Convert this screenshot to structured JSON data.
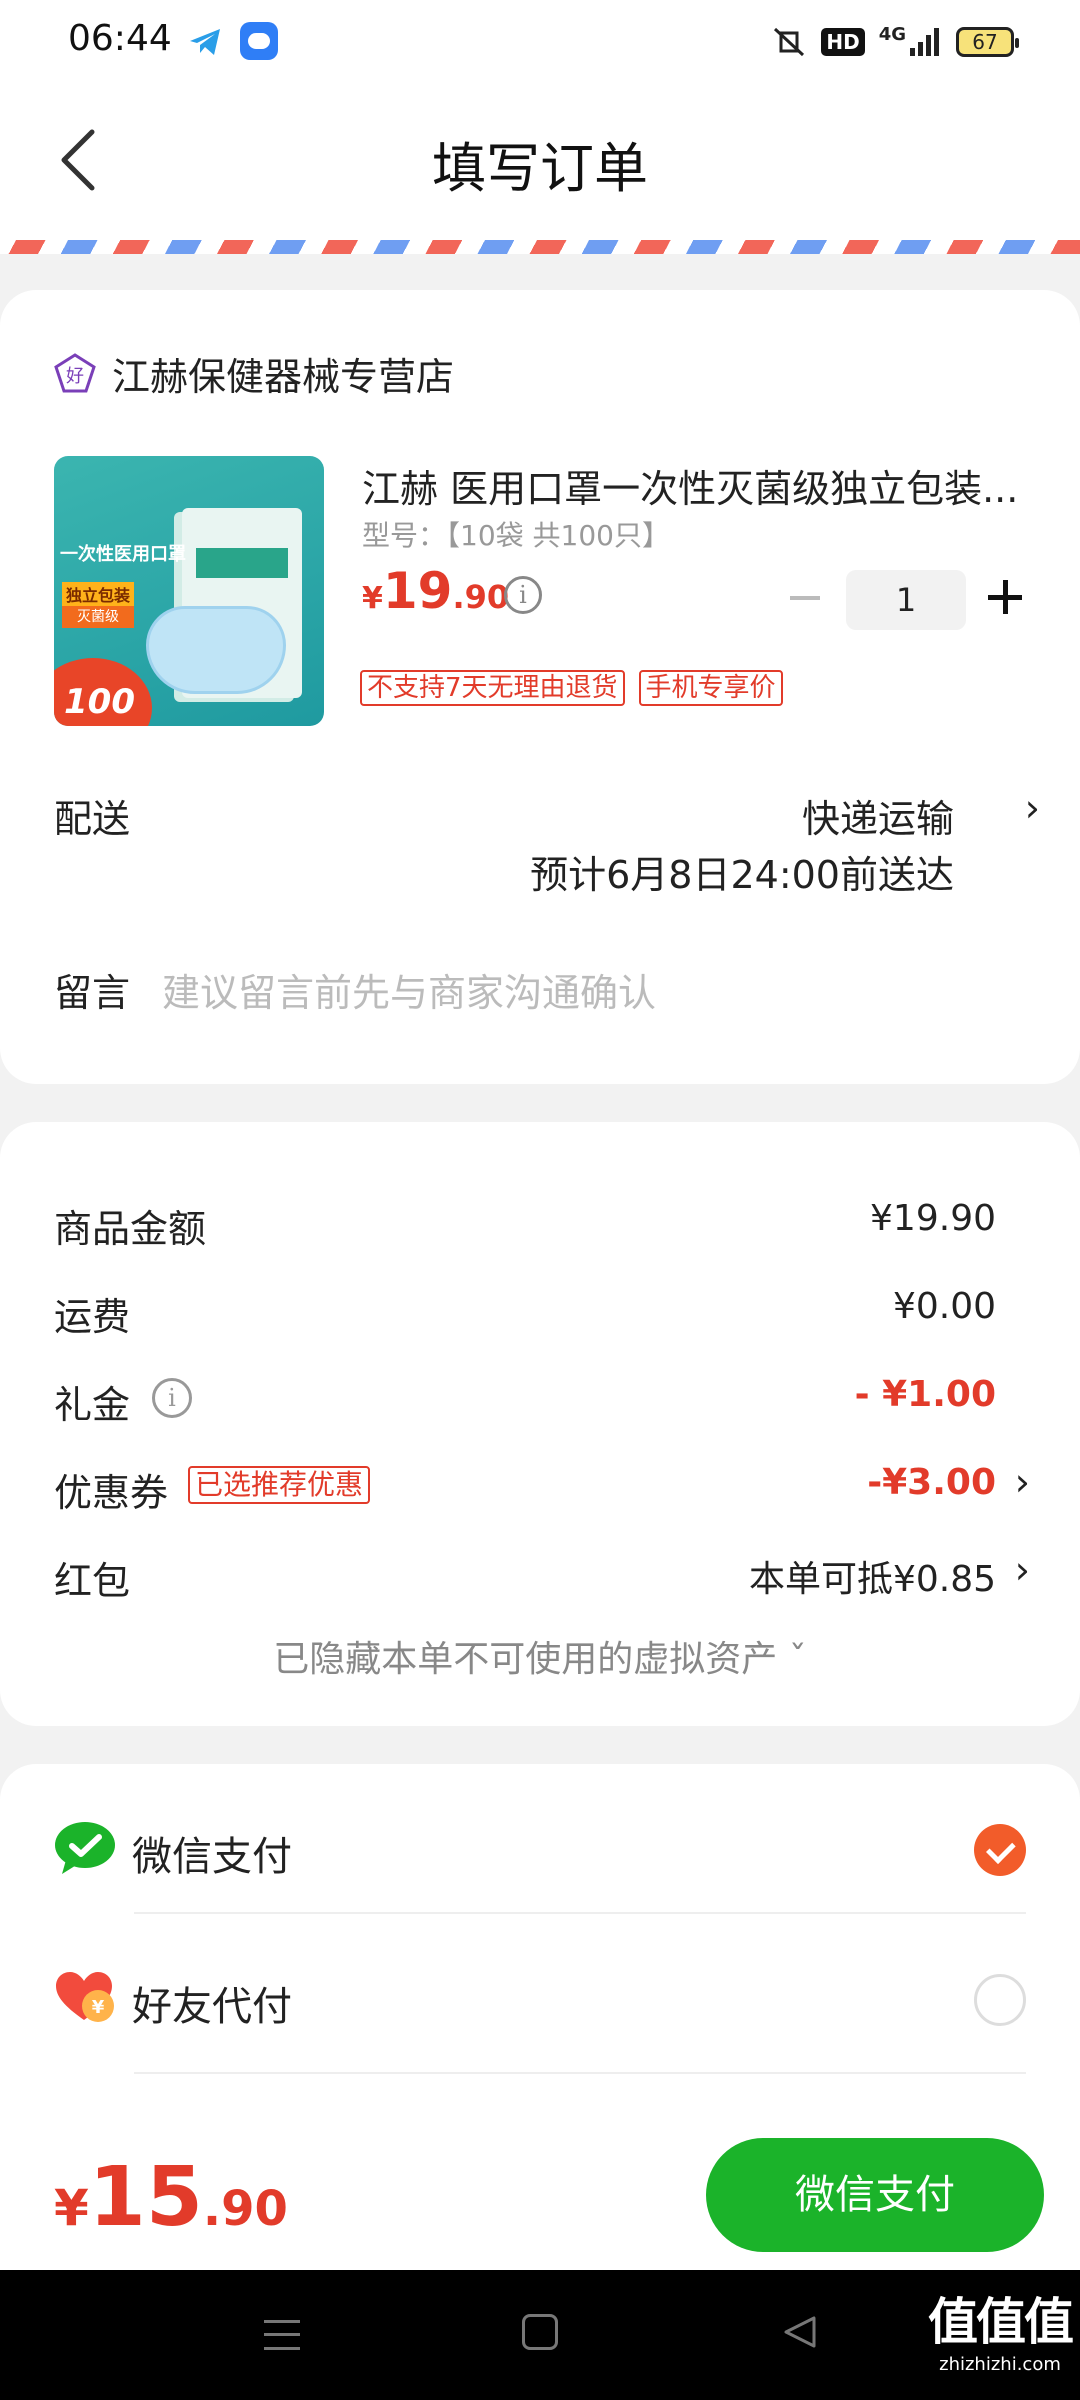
{
  "status_bar": {
    "time": "06:44",
    "network": "4G",
    "hd_label": "HD",
    "battery": "67"
  },
  "header": {
    "title": "填写订单"
  },
  "store": {
    "name": "江赫保健器械专营店",
    "badge_char": "好"
  },
  "product": {
    "title": "江赫 医用口罩一次性灭菌级独立包装...",
    "spec": "型号：【10袋 共100只】",
    "price_currency": "¥",
    "price_int": "19",
    "price_dec": ".90",
    "quantity": "1",
    "thumb_text": {
      "headline": "一次性医用口罩",
      "tag1": "独立包装",
      "tag2": "灭菌级",
      "badge": "100"
    },
    "tags": [
      "不支持7天无理由退货",
      "手机专享价"
    ]
  },
  "delivery": {
    "label": "配送",
    "method": "快递运输",
    "eta": "预计6月8日24:00前送达"
  },
  "message": {
    "label": "留言",
    "placeholder": "建议留言前先与商家沟通确认"
  },
  "amounts": {
    "goods_label": "商品金额",
    "goods_value": "¥19.90",
    "shipping_label": "运费",
    "shipping_value": "¥0.00",
    "gift_label": "礼金",
    "gift_value": "- ¥1.00",
    "coupon_label": "优惠券",
    "coupon_tag": "已选推荐优惠",
    "coupon_value": "-¥3.00",
    "redpacket_label": "红包",
    "redpacket_value": "本单可抵¥0.85",
    "hidden_assets": "已隐藏本单不可使用的虚拟资产 ˇ"
  },
  "payment": {
    "methods": [
      {
        "label": "微信支付",
        "selected": true
      },
      {
        "label": "好友代付",
        "selected": false
      }
    ]
  },
  "footer": {
    "total_currency": "¥",
    "total_int": "15",
    "total_dec": ".90",
    "pay_button": "微信支付"
  },
  "watermark": {
    "logo": "值值值",
    "url": "zhizhizhi.com"
  },
  "colors": {
    "accent_red": "#e23b2a",
    "wechat_green": "#1bb32a",
    "check_orange": "#f25c2a"
  }
}
